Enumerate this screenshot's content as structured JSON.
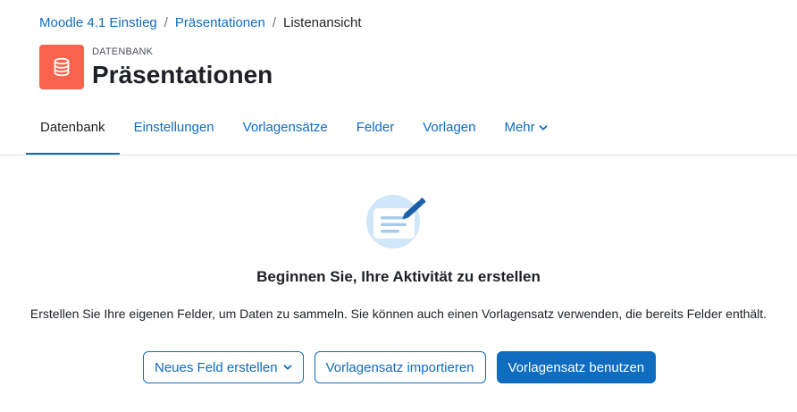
{
  "breadcrumb": {
    "items": [
      {
        "label": "Moodle 4.1 Einstieg"
      },
      {
        "label": "Präsentationen"
      },
      {
        "label": "Listenansicht"
      }
    ],
    "separator": "/"
  },
  "header": {
    "activity_type": "DATENBANK",
    "title": "Präsentationen",
    "icon": "database-icon",
    "icon_color": "#f7634d"
  },
  "tabs": [
    {
      "label": "Datenbank",
      "active": true
    },
    {
      "label": "Einstellungen"
    },
    {
      "label": "Vorlagensätze"
    },
    {
      "label": "Felder"
    },
    {
      "label": "Vorlagen"
    },
    {
      "label": "Mehr",
      "has_dropdown": true
    }
  ],
  "empty_state": {
    "icon": "document-edit-icon",
    "title": "Beginnen Sie, Ihre Aktivität zu erstellen",
    "text": "Erstellen Sie Ihre eigenen Felder, um Daten zu sammeln. Sie können auch einen Vorlagensatz verwenden, die bereits Felder enthält."
  },
  "actions": {
    "new_field": "Neues Feld erstellen",
    "import_preset": "Vorlagensatz importieren",
    "use_preset": "Vorlagensatz benutzen"
  },
  "colors": {
    "link": "#0f6cbf",
    "primary": "#0f6cbf",
    "text": "#1d2125"
  }
}
